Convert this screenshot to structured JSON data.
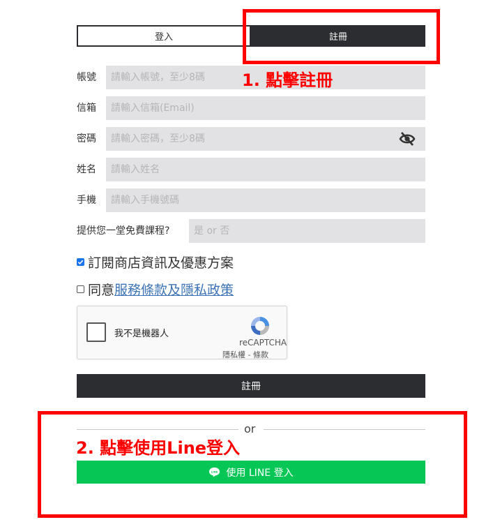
{
  "tabs": {
    "login": "登入",
    "register": "註冊"
  },
  "fields": [
    {
      "label": "帳號",
      "placeholder": "請輸入帳號，至少8碼",
      "value": ""
    },
    {
      "label": "信箱",
      "placeholder": "請輸入信箱(Email)",
      "value": ""
    },
    {
      "label": "密碼",
      "placeholder": "請輸入密碼，至少8碼",
      "value": ""
    },
    {
      "label": "姓名",
      "placeholder": "請輸入姓名",
      "value": ""
    },
    {
      "label": "手機",
      "placeholder": "請輸入手機號碼",
      "value": ""
    },
    {
      "label": "提供您一堂免費課程?",
      "placeholder": "是 or 否",
      "value": ""
    }
  ],
  "subscribe": {
    "label": "訂閱商店資訊及優惠方案",
    "checked": true
  },
  "agree": {
    "prefix": "同意",
    "link": "服務條款及隱私政策",
    "checked": false
  },
  "recaptcha": {
    "label": "我不是機器人",
    "brand": "reCAPTCHA",
    "privacy": "隱私權 - 條款"
  },
  "submit_label": "註冊",
  "or_text": "or",
  "line_button": {
    "icon": "line-chat-icon",
    "label": "使用 LINE 登入"
  },
  "annotations": {
    "step1": "1. 點擊註冊",
    "step2": "2. 點擊使用Line登入",
    "color": "#ff0000"
  },
  "colors": {
    "dark": "#2b2d31",
    "input_bg": "#e2e2e4",
    "line_green": "#06c755",
    "link": "#3c73b6"
  }
}
